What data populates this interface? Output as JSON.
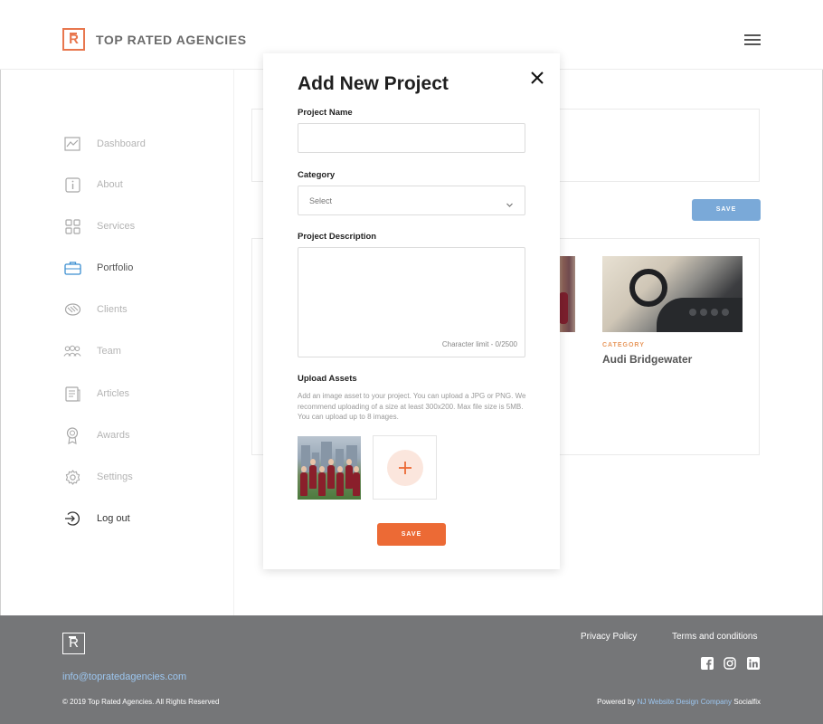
{
  "header": {
    "brand": "TOP RATED AGENCIES",
    "logo_letter": "R"
  },
  "sidebar": {
    "items": [
      {
        "label": "Dashboard",
        "icon": "chart-icon"
      },
      {
        "label": "About",
        "icon": "info-icon"
      },
      {
        "label": "Services",
        "icon": "grid-icon"
      },
      {
        "label": "Portfolio",
        "icon": "briefcase-icon",
        "active": true
      },
      {
        "label": "Clients",
        "icon": "handshake-icon"
      },
      {
        "label": "Team",
        "icon": "team-icon"
      },
      {
        "label": "Articles",
        "icon": "article-icon"
      },
      {
        "label": "Awards",
        "icon": "award-icon"
      },
      {
        "label": "Settings",
        "icon": "gear-icon"
      },
      {
        "label": "Log out",
        "icon": "logout-icon"
      }
    ]
  },
  "background": {
    "save_label": "SAVE",
    "card": {
      "category": "CATEGORY",
      "title": "Audi Bridgewater"
    }
  },
  "modal": {
    "title": "Add New Project",
    "project_name_label": "Project Name",
    "project_name_value": "",
    "category_label": "Category",
    "category_selected": "Select",
    "description_label": "Project Description",
    "description_value": "",
    "char_limit": "Character limit - 0/2500",
    "upload_label": "Upload Assets",
    "upload_help": "Add an image asset to your project.  You can upload a JPG or PNG.  We recommend uploading of a size at least 300x200.  Max file size is 5MB.  You can upload up to 8 images.",
    "save_label": "SAVE"
  },
  "footer": {
    "logo_letter": "R",
    "email": "info@topratedagencies.com",
    "copyright": "© 2019 Top Rated Agencies. All Rights Reserved",
    "privacy": "Privacy Policy",
    "terms": "Terms and conditions",
    "powered_prefix": "Powered by",
    "powered_link": "NJ Website Design Company",
    "powered_suffix": "Socialfix"
  },
  "colors": {
    "accent": "#ec6a35",
    "blue": "#7aa9d8",
    "footer_bg": "#757678",
    "link": "#9cc6f0"
  }
}
